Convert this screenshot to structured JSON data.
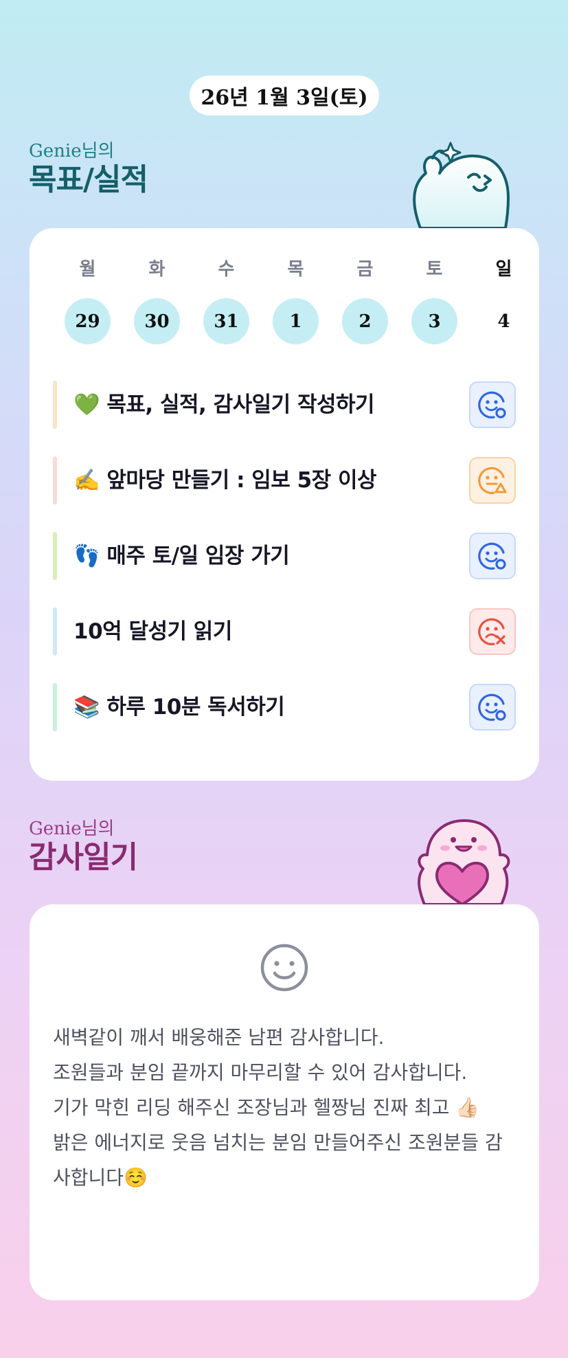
{
  "header": {
    "date": "26년 1월 3일(토)"
  },
  "goals_section": {
    "subtitle": "Genie님의",
    "title": "목표/실적",
    "week": {
      "days": [
        {
          "label": "월",
          "date": "29",
          "completed": true
        },
        {
          "label": "화",
          "date": "30",
          "completed": true
        },
        {
          "label": "수",
          "date": "31",
          "completed": true
        },
        {
          "label": "목",
          "date": "1",
          "completed": true
        },
        {
          "label": "금",
          "date": "2",
          "completed": true
        },
        {
          "label": "토",
          "date": "3",
          "completed": true
        },
        {
          "label": "일",
          "date": "4",
          "completed": false
        }
      ]
    },
    "goals": [
      {
        "text": "💚 목표, 실적, 감사일기 작성하기",
        "bar_color": "#fde2c4",
        "status": "achieved",
        "status_color": "#2f66e0"
      },
      {
        "text": "✍️ 앞마당 만들기 : 임보 5장 이상",
        "bar_color": "#fcd9d6",
        "status": "partial",
        "status_color": "#f29a36"
      },
      {
        "text": "👣 매주 토/일 임장 가기",
        "bar_color": "#d8f0b8",
        "status": "achieved",
        "status_color": "#2f66e0"
      },
      {
        "text": "10억 달성기 읽기",
        "bar_color": "#cfe8fb",
        "status": "failed",
        "status_color": "#e8503f"
      },
      {
        "text": "📚 하루 10분 독서하기",
        "bar_color": "#c8f0da",
        "status": "achieved",
        "status_color": "#2f66e0"
      }
    ]
  },
  "thanks_section": {
    "subtitle": "Genie님의",
    "title": "감사일기",
    "mood_icon": "smile-icon",
    "lines": [
      "새벽같이 깨서 배웅해준 남편 감사합니다.",
      "조원들과 분임 끝까지 마무리할 수 있어 감사합니다.",
      "기가 막힌 리딩 해주신 조장님과 헬짱님 진짜 최고 👍🏻",
      "밝은 에너지로 웃음 넘치는 분임 만들어주신 조원분들 감사합니다☺️"
    ]
  }
}
